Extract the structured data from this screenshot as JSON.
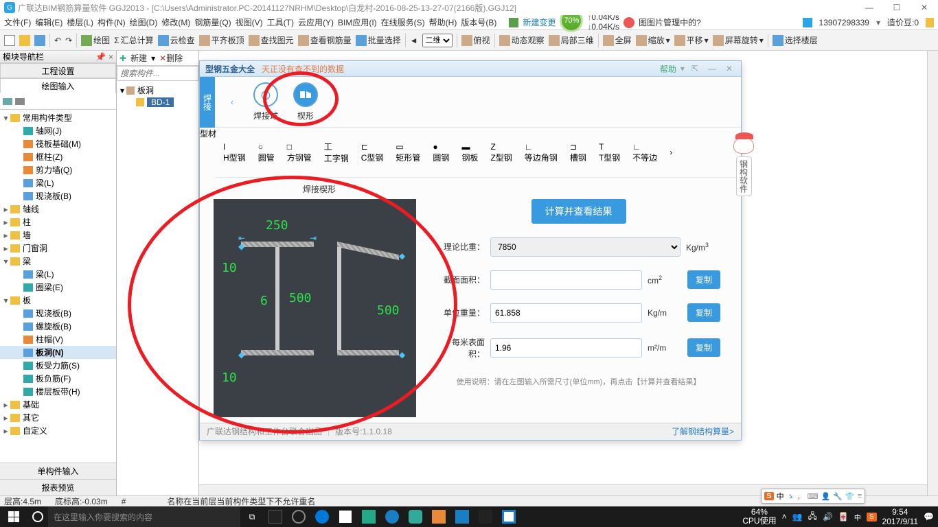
{
  "window": {
    "title": "广联达BIM钢筋算量软件 GGJ2013 - [C:\\Users\\Administrator.PC-20141127NRHM\\Desktop\\白龙村-2016-08-25-13-27-07(2166版).GGJ12]"
  },
  "menu": {
    "items": [
      "文件(F)",
      "编辑(E)",
      "楼层(L)",
      "构件(N)",
      "绘图(D)",
      "修改(M)",
      "钢筋量(Q)",
      "视图(V)",
      "工具(T)",
      "云应用(Y)",
      "BIM应用(I)",
      "在线服务(S)",
      "帮助(H)",
      "版本号(B)"
    ],
    "new_change": "新建变更",
    "percent": "70%",
    "net_up": "0.04K/s",
    "net_dn": "0.04K/s",
    "right_msg": "图图片管理中的?",
    "phone": "13907298339",
    "price_label": "造价豆:0"
  },
  "toolbar": {
    "items": [
      "绘图",
      "汇总计算",
      "云检查",
      "平齐板顶",
      "查找图元",
      "查看钢筋量",
      "批量选择"
    ],
    "view_mode": "二维",
    "right_items": [
      "俯视",
      "动态观察",
      "局部三维",
      "全屏",
      "缩放",
      "平移",
      "屏幕旋转",
      "选择楼层"
    ]
  },
  "nav": {
    "header": "模块导航栏",
    "tab1": "工程设置",
    "tab2": "绘图输入",
    "groups": [
      {
        "label": "常用构件类型",
        "open": true,
        "children": [
          {
            "label": "轴网(J)",
            "icon": "teal"
          },
          {
            "label": "筏板基础(M)",
            "icon": "orange"
          },
          {
            "label": "框柱(Z)",
            "icon": "orange"
          },
          {
            "label": "剪力墙(Q)",
            "icon": "orange"
          },
          {
            "label": "梁(L)",
            "icon": "blue"
          },
          {
            "label": "现浇板(B)",
            "icon": "blue"
          }
        ]
      },
      {
        "label": "轴线",
        "open": false
      },
      {
        "label": "柱",
        "open": false
      },
      {
        "label": "墙",
        "open": false
      },
      {
        "label": "门窗洞",
        "open": false
      },
      {
        "label": "梁",
        "open": true,
        "children": [
          {
            "label": "梁(L)",
            "icon": "blue"
          },
          {
            "label": "圈梁(E)",
            "icon": "teal"
          }
        ]
      },
      {
        "label": "板",
        "open": true,
        "children": [
          {
            "label": "现浇板(B)",
            "icon": "blue"
          },
          {
            "label": "螺旋板(B)",
            "icon": "blue"
          },
          {
            "label": "柱帽(V)",
            "icon": "orange"
          },
          {
            "label": "板洞(N)",
            "icon": "blue",
            "bold": true,
            "selected": true
          },
          {
            "label": "板受力筋(S)",
            "icon": "teal"
          },
          {
            "label": "板负筋(F)",
            "icon": "teal"
          },
          {
            "label": "楼层板带(H)",
            "icon": "teal"
          }
        ]
      },
      {
        "label": "基础",
        "open": false
      },
      {
        "label": "其它",
        "open": false
      },
      {
        "label": "自定义",
        "open": false
      }
    ],
    "bottom1": "单构件输入",
    "bottom2": "报表预览"
  },
  "tree_col": {
    "new": "新建",
    "del": "删除",
    "search_ph": "搜索构件...",
    "root": "板洞",
    "child": "BD-1"
  },
  "dialog": {
    "title": "型钢五金大全",
    "subtitle": "天正没有查不到的数据",
    "help": "帮助",
    "side_tab_weld": "焊接",
    "side_tab_steel": "型材",
    "weld_items": [
      "焊接球",
      "楔形"
    ],
    "steel_items": [
      "H型钢",
      "圆管",
      "方钢管",
      "工字钢",
      "C型钢",
      "矩形管",
      "圆钢",
      "钢板",
      "Z型钢",
      "等边角钢",
      "槽钢",
      "T型钢",
      "不等边"
    ],
    "section_title": "焊接楔形",
    "calc_btn": "计算并查看结果",
    "fields": {
      "density_label": "理论比重：",
      "density_value": "7850",
      "density_unit": "Kg/m",
      "area_label": "截面面积：",
      "area_value": "",
      "area_unit": "cm",
      "unit_weight_label": "单位重量：",
      "unit_weight_value": "61.858",
      "unit_weight_unit": "Kg/m",
      "surface_label": "每米表面积：",
      "surface_value": "1.96",
      "surface_unit": "m²/m",
      "copy": "复制"
    },
    "hint": "使用说明：请在左图输入所需尺寸(单位mm)，再点击【计算并查看结果】",
    "footer_left": "广联达钢结构和工作台联合出品",
    "footer_ver": "版本号:1.1.0.18",
    "footer_link": "了解钢结构算量>",
    "diagram": {
      "top": "250",
      "t1": "10",
      "t2": "10",
      "web": "6",
      "h": "500",
      "h2": "500"
    }
  },
  "assistant_tag": "钢构软件",
  "status": {
    "floor": "层高:4.5m",
    "floor_bottom": "底标高:-0.03m",
    "others": "#",
    "msg": "名称在当前层当前构件类型下不允许重名"
  },
  "taskbar": {
    "search_ph": "在这里输入你要搜索的内容",
    "cpu_pct": "64%",
    "cpu_label": "CPU使用",
    "time": "9:54",
    "date": "2017/9/11",
    "ime_lang": "中"
  },
  "imetip": {
    "lang": "中",
    "punct": "ゝ",
    "full": "，",
    "soft": "•"
  }
}
